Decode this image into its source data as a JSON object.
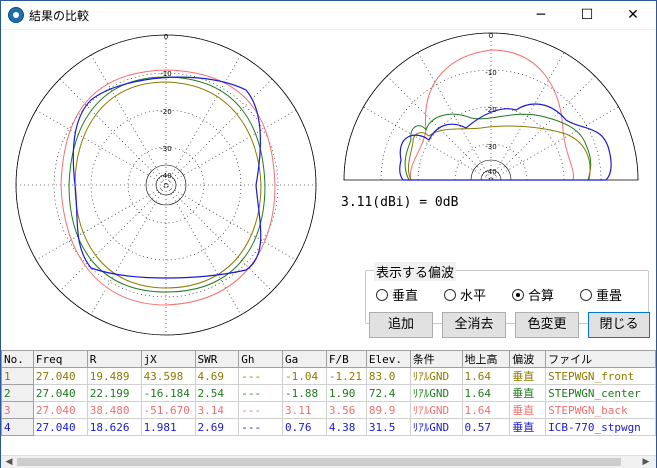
{
  "window": {
    "title": "結果の比較",
    "minimize_glyph": "─",
    "maximize_glyph": "☐",
    "close_glyph": "✕"
  },
  "plot_labels": {
    "azimuth": [
      "0",
      "-10",
      "-20",
      "-30",
      "-40"
    ],
    "elevation": [
      "0",
      "-10",
      "-20",
      "-30",
      "-40"
    ]
  },
  "dbi_text": "3.11(dBi) = 0dB",
  "polarization": {
    "title": "表示する偏波",
    "options": [
      {
        "label": "垂直",
        "selected": false
      },
      {
        "label": "水平",
        "selected": false
      },
      {
        "label": "合算",
        "selected": true
      },
      {
        "label": "重畳",
        "selected": false
      }
    ]
  },
  "buttons": {
    "add": "追加",
    "clear": "全消去",
    "color": "色変更",
    "close": "閉じる"
  },
  "table": {
    "headers": [
      "No.",
      "Freq",
      "R",
      "jX",
      "SWR",
      "Gh",
      "Ga",
      "F/B",
      "Elev.",
      "条件",
      "地上高",
      "偏波",
      "ファイル"
    ],
    "rows": [
      {
        "color": "#8c7a00",
        "cells": [
          "1",
          "27.040",
          "19.489",
          "43.598",
          "4.69",
          "---",
          "-1.04",
          "-1.21",
          "83.0",
          "ﾘｱﾙGND",
          "1.64",
          "垂直",
          "STEPWGN_front"
        ]
      },
      {
        "color": "#1f7a1f",
        "cells": [
          "2",
          "27.040",
          "22.199",
          "-16.184",
          "2.54",
          "---",
          "-1.88",
          "1.90",
          "72.4",
          "ﾘｱﾙGND",
          "1.64",
          "垂直",
          "STEPWGN_center"
        ]
      },
      {
        "color": "#f07070",
        "cells": [
          "3",
          "27.040",
          "38.480",
          "-51.670",
          "3.14",
          "---",
          "3.11",
          "3.56",
          "89.9",
          "ﾘｱﾙGND",
          "1.64",
          "垂直",
          "STEPWGN_back"
        ]
      },
      {
        "color": "#1a1ad6",
        "cells": [
          "4",
          "27.040",
          "18.626",
          "1.981",
          "2.69",
          "---",
          "0.76",
          "4.38",
          "31.5",
          "ﾘｱﾙGND",
          "0.57",
          "垂直",
          "ICB-770_stpwgn"
        ]
      }
    ]
  },
  "colors": {
    "trace1": "#8c7a00",
    "trace2": "#1f7a1f",
    "trace3": "#f07070",
    "trace4": "#1a1ad6"
  }
}
